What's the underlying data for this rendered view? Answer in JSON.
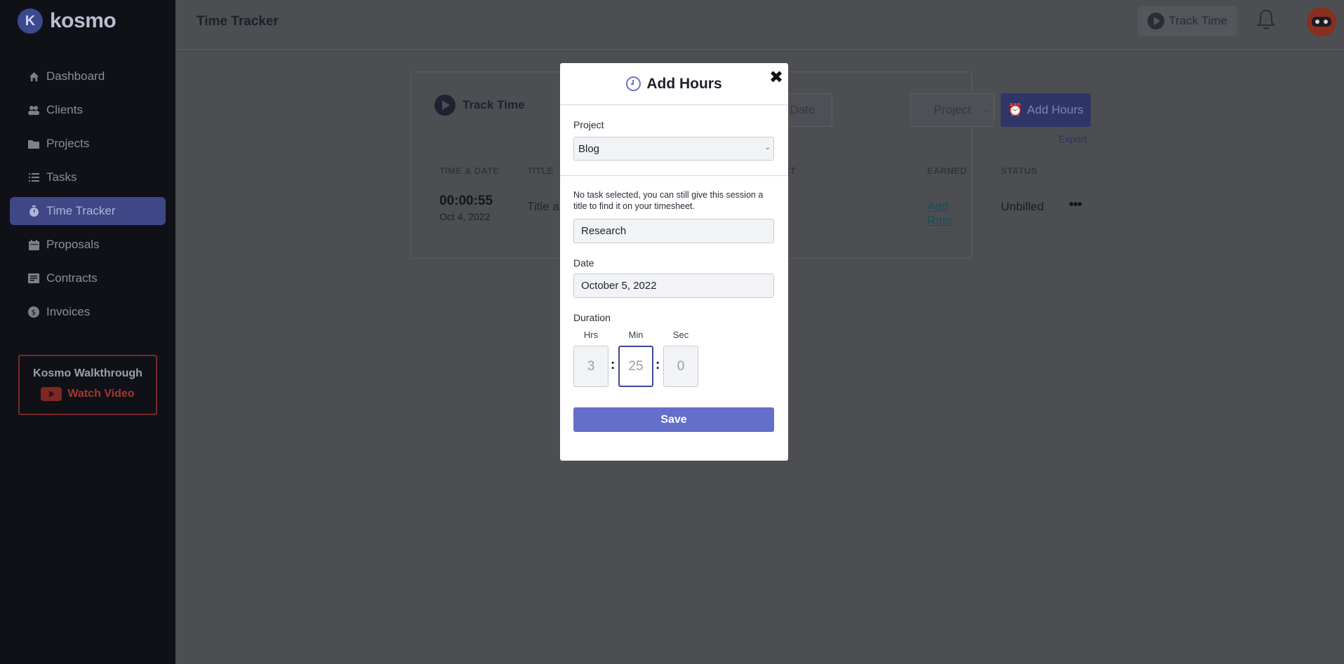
{
  "app": {
    "logo_text": "kosmo"
  },
  "sidebar": {
    "items": [
      {
        "label": "Dashboard",
        "icon": "home-icon"
      },
      {
        "label": "Clients",
        "icon": "users-icon"
      },
      {
        "label": "Projects",
        "icon": "folder-icon"
      },
      {
        "label": "Tasks",
        "icon": "list-icon"
      },
      {
        "label": "Time Tracker",
        "icon": "stopwatch-icon",
        "active": true
      },
      {
        "label": "Proposals",
        "icon": "calendar-icon"
      },
      {
        "label": "Contracts",
        "icon": "document-icon"
      },
      {
        "label": "Invoices",
        "icon": "dollar-icon"
      }
    ],
    "walkthrough": {
      "title": "Kosmo Walkthrough",
      "video_label": "Watch Video"
    }
  },
  "header": {
    "title": "Time Tracker",
    "track_time_label": "Track Time"
  },
  "card": {
    "track_time_label": "Track Time",
    "filters": {
      "start_date_partial": "te",
      "end_date": "End Date",
      "project": "Project"
    },
    "add_hours_label": "Add Hours",
    "export_label": "Export",
    "columns": {
      "time_date": "TIME & DATE",
      "title": "TITLE",
      "project_partial": "CT",
      "earned": "EARNED",
      "status": "STATUS"
    },
    "rows": [
      {
        "time": "00:00:55",
        "date": "Oct 4, 2022",
        "title_partial": "Title a",
        "earned": "Add Rate",
        "status": "Unbilled",
        "menu": "•••"
      }
    ]
  },
  "modal": {
    "title": "Add Hours",
    "close": "✖",
    "project_label": "Project",
    "project_value": "Blog",
    "hint": "No task selected, you can still give this session a title to find it on your timesheet.",
    "title_value": "Research",
    "date_label": "Date",
    "date_value": "October 5, 2022",
    "duration_label": "Duration",
    "hrs_label": "Hrs",
    "min_label": "Min",
    "sec_label": "Sec",
    "hrs_value": "3",
    "min_value": "25",
    "sec_value": "0",
    "separator": ":",
    "save_label": "Save"
  },
  "colors": {
    "accent": "#646fca",
    "sidebar_bg": "#0f1117",
    "overlay": "#4d4e52",
    "active_nav": "#3f4786"
  }
}
